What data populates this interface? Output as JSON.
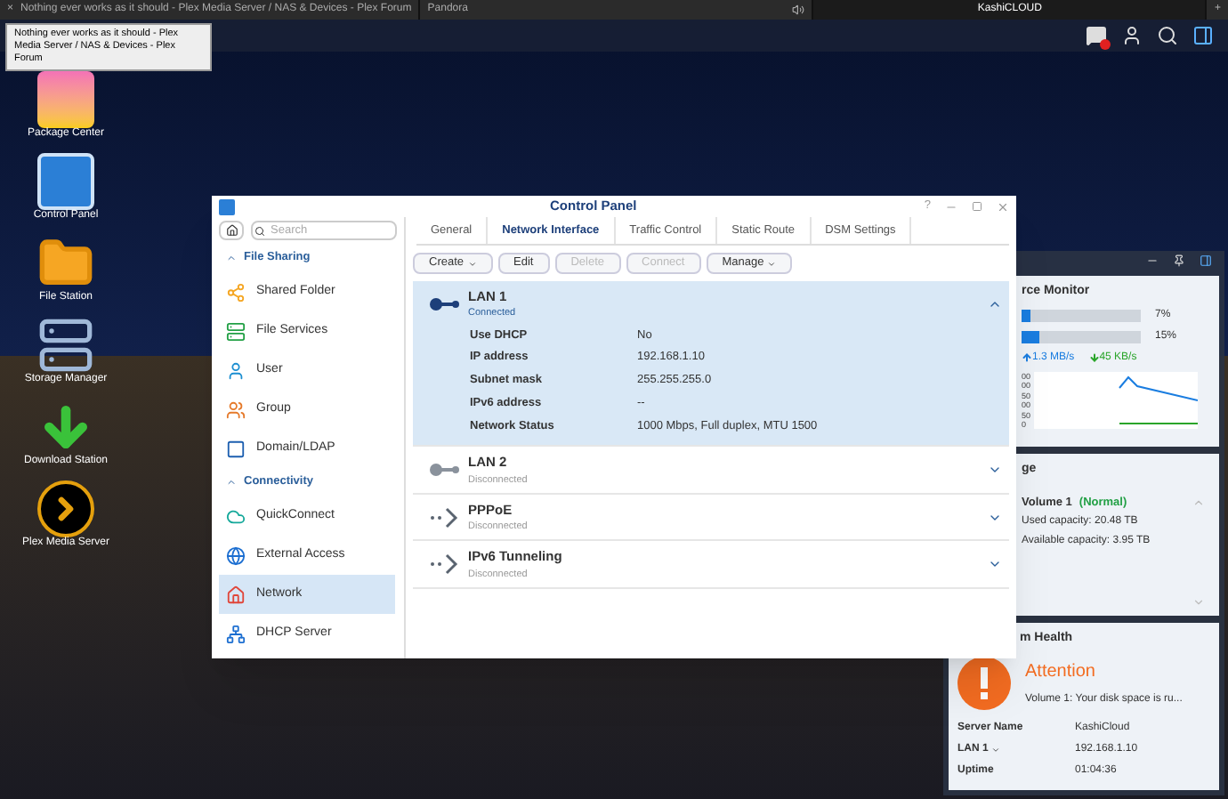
{
  "browser_tabs": [
    {
      "title": "Nothing ever works as it should - Plex Media Server / NAS & Devices - Plex Forum",
      "selected": false,
      "close": "×",
      "muted": false
    },
    {
      "title": "Pandora",
      "selected": false,
      "muted": true
    },
    {
      "title": "KashiCLOUD",
      "selected": true,
      "muted": false
    }
  ],
  "new_tab": "+",
  "tooltip": "Nothing ever works as it should - Plex Media Server / NAS & Devices - Plex Forum",
  "taskbar": {
    "notification_badge": true
  },
  "desktop_icons": [
    {
      "label": "Package Center",
      "kind": "package"
    },
    {
      "label": "Control Panel",
      "kind": "control"
    },
    {
      "label": "File Station",
      "kind": "folder"
    },
    {
      "label": "Storage Manager",
      "kind": "storage"
    },
    {
      "label": "Download Station",
      "kind": "download"
    },
    {
      "label": "Plex Media Server",
      "kind": "plex"
    }
  ],
  "control_panel": {
    "title": "Control Panel",
    "help": "?",
    "search": {
      "placeholder": "Search"
    },
    "sidebar": [
      {
        "title": "File Sharing",
        "expanded": true,
        "items": [
          {
            "label": "Shared Folder",
            "kind": "share",
            "selected": false
          },
          {
            "label": "File Services",
            "kind": "services",
            "selected": false
          },
          {
            "label": "User",
            "kind": "user",
            "selected": false
          },
          {
            "label": "Group",
            "kind": "group",
            "selected": false
          },
          {
            "label": "Domain/LDAP",
            "kind": "domain",
            "selected": false
          }
        ]
      },
      {
        "title": "Connectivity",
        "expanded": true,
        "items": [
          {
            "label": "QuickConnect",
            "kind": "cloud",
            "selected": false
          },
          {
            "label": "External Access",
            "kind": "globe",
            "selected": false
          },
          {
            "label": "Network",
            "kind": "home",
            "selected": true
          },
          {
            "label": "DHCP Server",
            "kind": "dhcp",
            "selected": false
          }
        ]
      }
    ],
    "tabs": [
      {
        "label": "General",
        "selected": false
      },
      {
        "label": "Network Interface",
        "selected": true
      },
      {
        "label": "Traffic Control",
        "selected": false
      },
      {
        "label": "Static Route",
        "selected": false
      },
      {
        "label": "DSM Settings",
        "selected": false
      }
    ],
    "toolbar": [
      {
        "label": "Create",
        "dropdown": true,
        "disabled": false
      },
      {
        "label": "Edit",
        "dropdown": false,
        "disabled": false
      },
      {
        "label": "Delete",
        "dropdown": false,
        "disabled": true
      },
      {
        "label": "Connect",
        "dropdown": false,
        "disabled": true
      },
      {
        "label": "Manage",
        "dropdown": true,
        "disabled": false
      }
    ],
    "interfaces": [
      {
        "name": "LAN 1",
        "status": "Connected",
        "kind": "lan",
        "connected": true,
        "expanded": true,
        "details": [
          {
            "label": "Use DHCP",
            "value": "No"
          },
          {
            "label": "IP address",
            "value": "192.168.1.10"
          },
          {
            "label": "Subnet mask",
            "value": "255.255.255.0"
          },
          {
            "label": "IPv6 address",
            "value": "--"
          },
          {
            "label": "Network Status",
            "value": "1000 Mbps, Full duplex, MTU 1500"
          }
        ]
      },
      {
        "name": "LAN 2",
        "status": "Disconnected",
        "kind": "lan",
        "connected": false,
        "expanded": false
      },
      {
        "name": "PPPoE",
        "status": "Disconnected",
        "kind": "tunnel",
        "connected": false,
        "expanded": false
      },
      {
        "name": "IPv6 Tunneling",
        "status": "Disconnected",
        "kind": "tunnel",
        "connected": false,
        "expanded": false
      }
    ]
  },
  "widgets": {
    "resource_monitor": {
      "title": "rce Monitor",
      "meters": [
        {
          "level": 0.07,
          "reading": "7%"
        },
        {
          "level": 0.15,
          "reading": "15%"
        }
      ],
      "upload": "1.3 MB/s",
      "download": "45 KB/s",
      "axis_labels": [
        "00",
        "00",
        "50",
        "00",
        "50",
        "0"
      ]
    },
    "storage": {
      "title": "ge",
      "volume": "Volume 1",
      "status": "(Normal)",
      "used": "Used capacity: 20.48 TB",
      "available": "Available capacity: 3.95 TB"
    },
    "health": {
      "title": "m Health",
      "status": "Attention",
      "message": "Volume 1: Your disk space is ru...",
      "rows": [
        {
          "label": "Server Name",
          "value": "KashiCloud",
          "dropdown": false
        },
        {
          "label": "LAN 1",
          "value": "192.168.1.10",
          "dropdown": true
        },
        {
          "label": "Uptime",
          "value": "01:04:36",
          "dropdown": false
        }
      ]
    }
  }
}
